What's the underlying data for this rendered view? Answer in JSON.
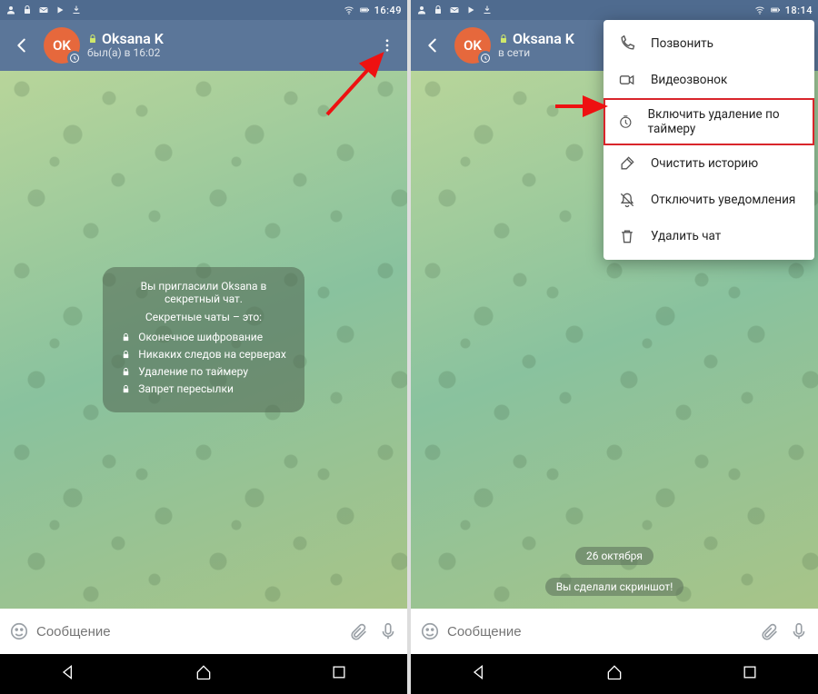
{
  "left": {
    "statusbar": {
      "time": "16:49"
    },
    "appbar": {
      "avatar_initials": "OK",
      "title": "Oksana K",
      "subtitle": "был(а) в 16:02"
    },
    "info": {
      "intro_l1": "Вы пригласили Oksana в",
      "intro_l2": "секретный чат.",
      "heading": "Секретные чаты – это:",
      "bullets": [
        "Оконечное шифрование",
        "Никаких следов на серверах",
        "Удаление по таймеру",
        "Запрет пересылки"
      ]
    },
    "input": {
      "placeholder": "Сообщение"
    }
  },
  "right": {
    "statusbar": {
      "time": "18:14"
    },
    "appbar": {
      "avatar_initials": "OK",
      "title": "Oksana K",
      "subtitle": "в сети"
    },
    "menu": {
      "items": [
        {
          "label": "Позвонить",
          "icon": "phone"
        },
        {
          "label": "Видеозвонок",
          "icon": "video"
        },
        {
          "label": "Включить удаление по таймеру",
          "icon": "timer",
          "highlight": true
        },
        {
          "label": "Очистить историю",
          "icon": "brush"
        },
        {
          "label": "Отключить уведомления",
          "icon": "bell-off"
        },
        {
          "label": "Удалить чат",
          "icon": "trash"
        }
      ]
    },
    "pills": {
      "date": "26 октября",
      "notice": "Вы сделали скриншот!"
    },
    "input": {
      "placeholder": "Сообщение"
    }
  }
}
